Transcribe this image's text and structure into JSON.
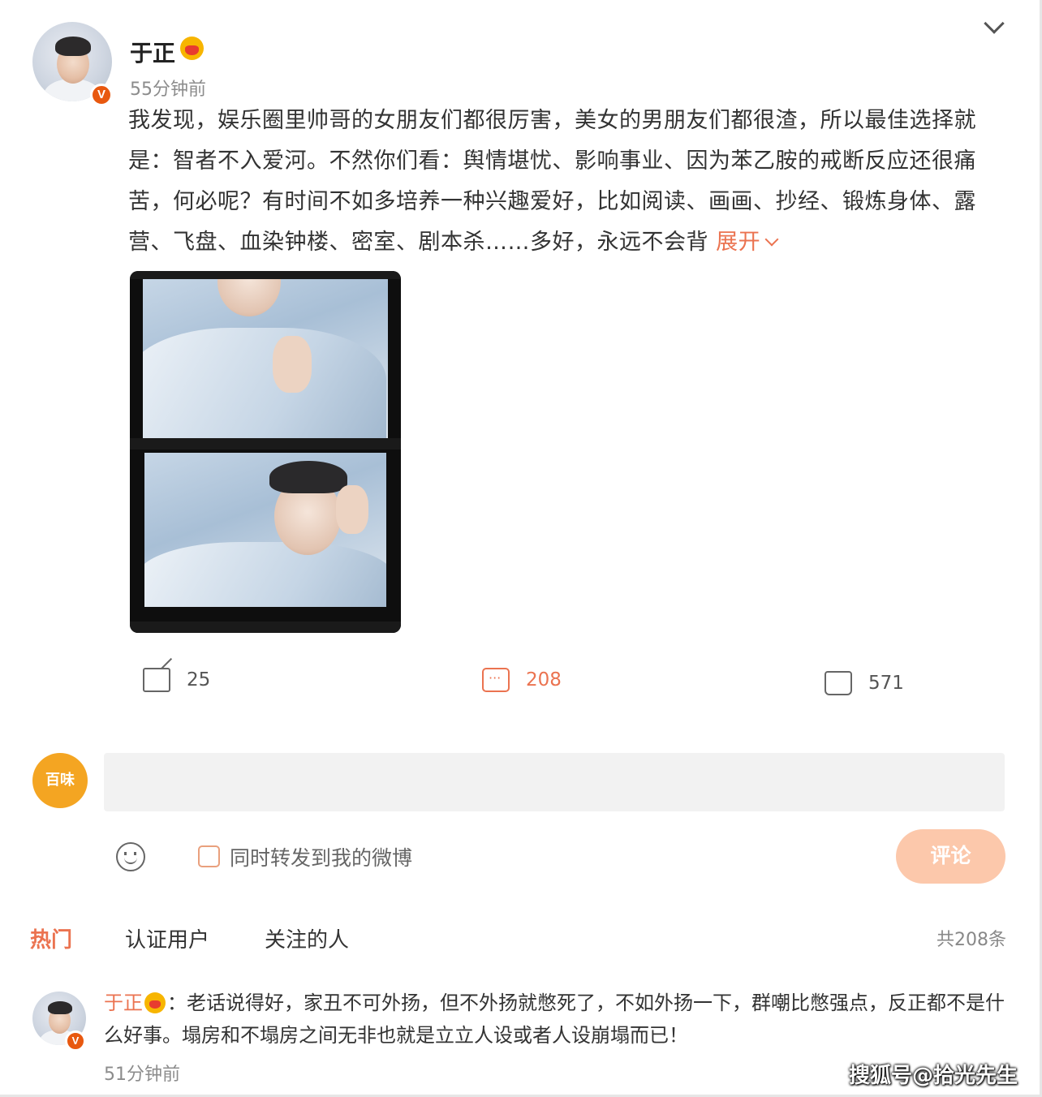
{
  "post": {
    "author": "于正",
    "time": "55分钟前",
    "text": "我发现，娱乐圈里帅哥的女朋友们都很厉害，美女的男朋友们都很渣，所以最佳选择就是：智者不入爱河。不然你们看：舆情堪忧、影响事业、因为苯乙胺的戒断反应还很痛苦，何必呢？有时间不如多培养一种兴趣爱好，比如阅读、画画、抄经、锻炼身体、露营、飞盘、血染钟楼、密室、剧本杀……多好，永远不会背",
    "expand_label": "展开"
  },
  "actions": {
    "share_count": "25",
    "comment_count": "208",
    "like_count": "571"
  },
  "composer": {
    "avatar_text": "百味",
    "input_placeholder": "",
    "repost_label": "同时转发到我的微博",
    "submit_label": "评论"
  },
  "comment_tabs": {
    "items": [
      "热门",
      "认证用户",
      "关注的人"
    ],
    "active": "热门",
    "total": "共208条"
  },
  "comment": {
    "author": "于正",
    "text": "：老话说得好，家丑不可外扬，但不外扬就憋死了，不如外扬一下，群嘲比憋强点，反正都不是什么好事。塌房和不塌房之间无非也就是立立人设或者人设崩塌而已！",
    "time": "51分钟前"
  },
  "watermark": "搜狐号@拾光先生",
  "colors": {
    "accent": "#eb7350",
    "badge": "#e8580f",
    "submit_disabled": "#fcc8ab",
    "composer_avatar": "#f4a522"
  },
  "icons": {
    "menu": "chevron-down-icon",
    "share": "share-icon",
    "comment": "comment-icon",
    "like": "thumbs-up-icon",
    "emoji": "smiley-icon"
  }
}
